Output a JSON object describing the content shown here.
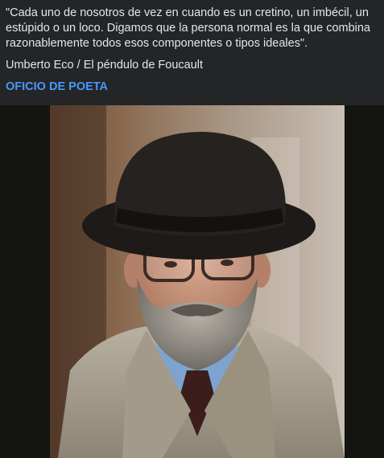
{
  "post": {
    "quote": "\"Cada uno de nosotros de vez en cuando es un cretino, un imbécil, un estúpido o un loco. Digamos que la persona normal es la que combina razonablemente todos esos componentes o tipos ideales\".",
    "attribution": "Umberto Eco / El péndulo de Foucault",
    "page_link": "OFICIO DE POETA"
  },
  "colors": {
    "background": "#242526",
    "text": "#e4e6eb",
    "link": "#4599ff",
    "photo_letterbox": "#141410"
  }
}
